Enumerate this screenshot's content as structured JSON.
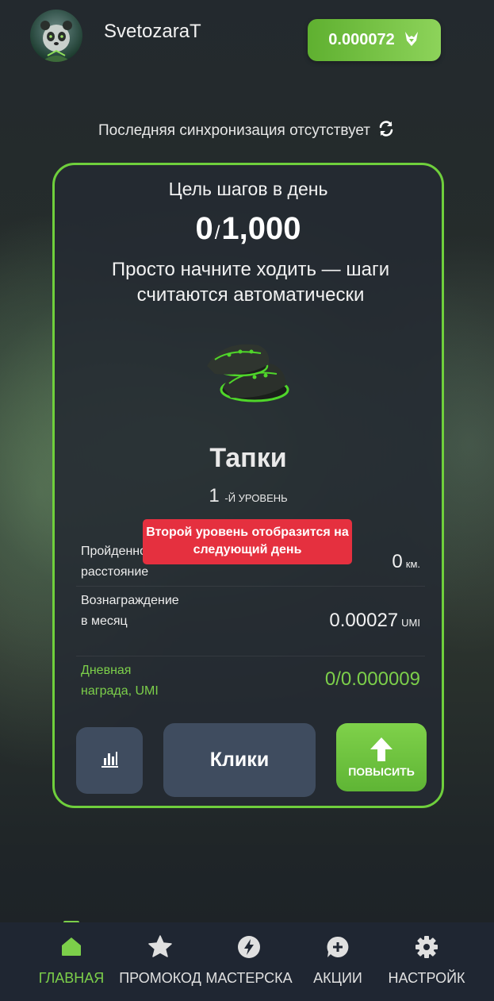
{
  "header": {
    "username": "SvetozaraT",
    "balance": "0.000072",
    "balance_icon": "umi-fox-icon"
  },
  "sync": {
    "text": "Последняя синхронизация отсутствует",
    "icon": "refresh-icon"
  },
  "card": {
    "goal_title": "Цель шагов в день",
    "goal_current": "0",
    "goal_separator": "/",
    "goal_target": "1,000",
    "goal_description": "Просто начните ходить — шаги считаются автоматически",
    "item_name": "Тапки",
    "item_level_num": "1",
    "item_level_suffix": "-Й УРОВЕНЬ",
    "tooltip": "Второй уровень отобразится на следующий день",
    "stats": [
      {
        "label": "Пройденное расстояние",
        "value": "0",
        "unit": "км."
      },
      {
        "label": "Вознаграждение в месяц",
        "value": "0.00027",
        "unit": "UMI"
      },
      {
        "label": "Дневная награда, UMI",
        "value": "0/0.000009",
        "unit": ""
      }
    ],
    "buttons": {
      "stats_icon": "bar-chart-icon",
      "clicks": "Клики",
      "upgrade": "ПОВЫСИТЬ"
    }
  },
  "nav": [
    {
      "label": "ГЛАВНАЯ",
      "icon": "home-icon",
      "active": true
    },
    {
      "label": "ПРОМОКОД",
      "icon": "star-icon",
      "active": false
    },
    {
      "label": "МАСТЕРСКА",
      "icon": "bolt-icon",
      "active": false
    },
    {
      "label": "АКЦИИ",
      "icon": "chat-plus-icon",
      "active": false
    },
    {
      "label": "НАСТРОЙК",
      "icon": "gear-icon",
      "active": false
    }
  ],
  "colors": {
    "accent_green": "#7ccf4a",
    "button_dark": "#3f4c5f",
    "tooltip_red": "#e5303f"
  }
}
